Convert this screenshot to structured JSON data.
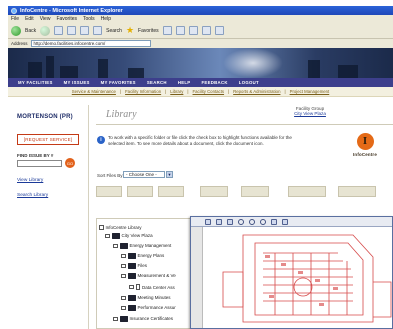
{
  "window": {
    "title": "InfoCentre - Microsoft Internet Explorer"
  },
  "menu": [
    "File",
    "Edit",
    "View",
    "Favorites",
    "Tools",
    "Help"
  ],
  "toolbar": {
    "back": "Back",
    "search": "Search",
    "favorites": "Favorites"
  },
  "address": {
    "label": "Address",
    "url": "http://demo.facilities.infocentre.com/"
  },
  "nav": [
    "MY FACILITIES",
    "MY ISSUES",
    "MY FAVORITES",
    "SEARCH",
    "HELP",
    "FEEDBACK",
    "LOGOUT"
  ],
  "subnav": [
    "Service & Maintenance",
    "Facility Information",
    "Library",
    "Facility Contacts",
    "Reports & Administration",
    "Project Management"
  ],
  "sidebar": {
    "logo": "MORTENSON (PR)",
    "request_button": "[REQUEST SERVICE]",
    "find_label": "FIND ISSUE BY #",
    "go": "GO",
    "links": [
      "View Library",
      "Search Library"
    ]
  },
  "main": {
    "title": "Library",
    "facility_group_label": "Facility Group",
    "facility_group_value": "City View Plaza",
    "instructions": "To work with a specific folder or file click the check box to highlight functions available for the selected item. To see more details about a document, click the document icon.",
    "brand": "InfoCentre",
    "brand_letter": "I",
    "sort_label": "Sort Files By:",
    "sort_value": "- Choose One -"
  },
  "tree": [
    "InfoCentre Library",
    "City View Plaza",
    "Energy Management",
    "Energy Plans",
    "Files",
    "Measurement & Ve",
    "Data Center Ass",
    "Meeting Minutes",
    "Performance Assur",
    "Insurance Certificates"
  ],
  "colors": {
    "nav_bg": "#3d3f8c",
    "accent_orange": "#e46a17",
    "request_red": "#c43a16",
    "link_blue": "#1b3a99"
  }
}
